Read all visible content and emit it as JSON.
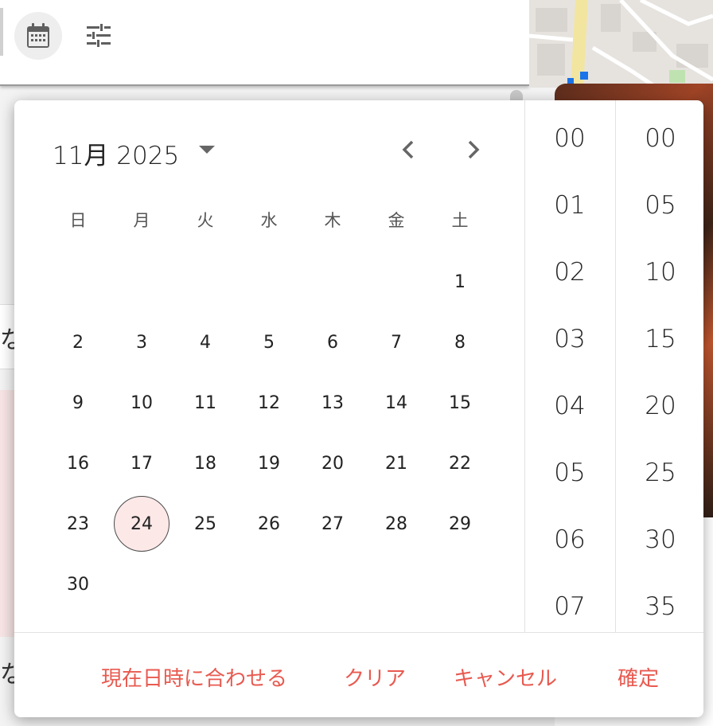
{
  "picker": {
    "month_label": "11月 2025",
    "weekdays": [
      "日",
      "月",
      "火",
      "水",
      "木",
      "金",
      "土"
    ],
    "days": [
      "1",
      "2",
      "3",
      "4",
      "5",
      "6",
      "7",
      "8",
      "9",
      "10",
      "11",
      "12",
      "13",
      "14",
      "15",
      "16",
      "17",
      "18",
      "19",
      "20",
      "21",
      "22",
      "23",
      "24",
      "25",
      "26",
      "27",
      "28",
      "29",
      "30"
    ],
    "first_weekday_index": 6,
    "selected_day": "24",
    "hours": [
      "00",
      "01",
      "02",
      "03",
      "04",
      "05",
      "06",
      "07"
    ],
    "minutes": [
      "00",
      "05",
      "10",
      "15",
      "20",
      "25",
      "30",
      "35"
    ],
    "actions": {
      "now": "現在日時に合わせる",
      "clear": "クリア",
      "cancel": "キャンセル",
      "confirm": "確定"
    }
  },
  "background": {
    "frag_a": "な",
    "frag_b": "な"
  },
  "colors": {
    "accent": "#e85a50",
    "selected_bg": "#fde8e8",
    "icon_gray": "#666666"
  },
  "icons": {
    "calendar": "calendar-icon",
    "tune": "tune-icon",
    "dropdown": "caret-down-icon",
    "prev": "chevron-left-icon",
    "next": "chevron-right-icon"
  }
}
